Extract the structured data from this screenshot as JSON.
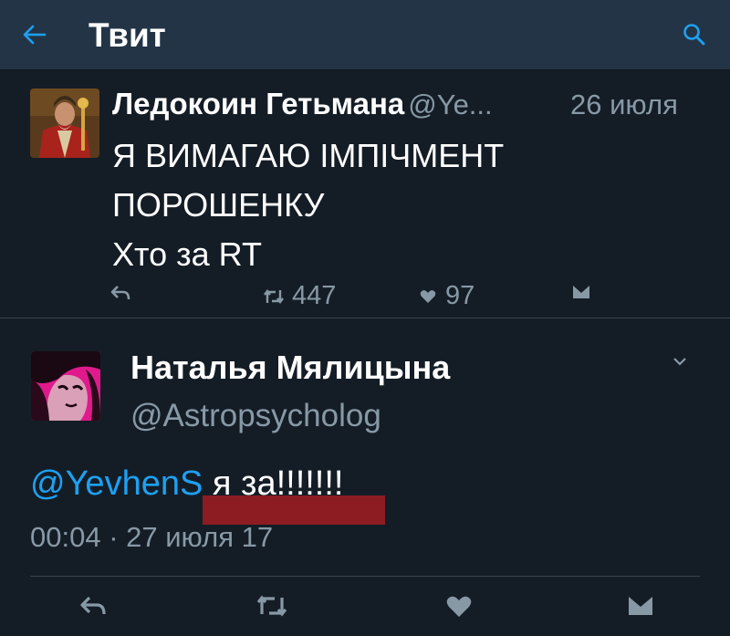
{
  "header": {
    "title": "Твит",
    "back_icon": "arrow-left-icon",
    "search_icon": "search-icon"
  },
  "tweet1": {
    "name": "Ледокоин Гетьмана",
    "handle": "@Ye...",
    "date": "26 июля",
    "text_lines": [
      "Я ВИМАГАЮ ІМПІЧМЕНТ",
      "ПОРОШЕНКУ",
      "Хто за RT"
    ],
    "retweets": "447",
    "likes": "97"
  },
  "tweet2": {
    "name": "Наталья Мялицына",
    "handle": "@Astropsycholog",
    "mention": "@YevhenS",
    "text": " я за!!!!!!!",
    "timestamp": "00:04 · 27 июля 17"
  },
  "colors": {
    "background": "#141d26",
    "header_bg": "#243447",
    "accent": "#1da1f2",
    "muted": "#8899a6",
    "redaction": "#8c1c22"
  }
}
